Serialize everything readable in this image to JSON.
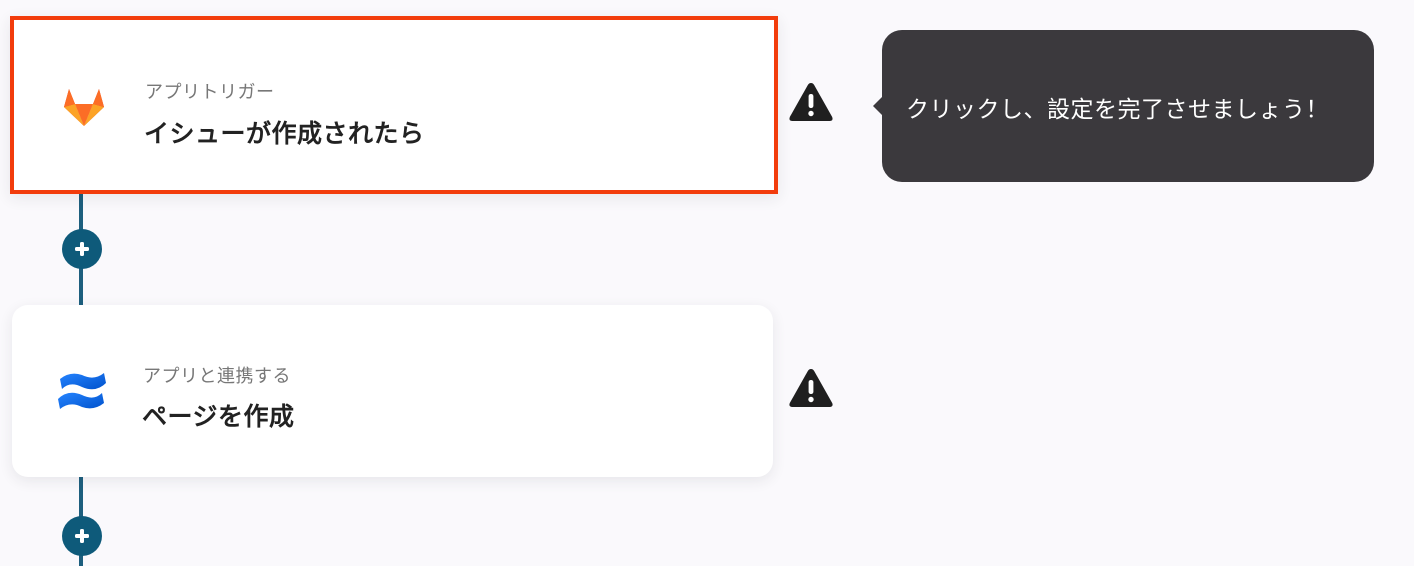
{
  "flow": {
    "steps": [
      {
        "subtitle": "アプリトリガー",
        "title": "イシューが作成されたら",
        "app_icon": "gitlab-icon",
        "selected": true,
        "warning": true
      },
      {
        "subtitle": "アプリと連携する",
        "title": "ページを作成",
        "app_icon": "confluence-icon",
        "selected": false,
        "warning": true
      }
    ],
    "add_step_icon": "plus-icon"
  },
  "tooltip": {
    "text": "クリックし、設定を完了させましょう！"
  },
  "colors": {
    "background": "#faf9fc",
    "selected_border": "#f23c0c",
    "connector": "#1d5f7e",
    "add_button": "#0e5a7a",
    "tooltip_bg": "#3b393d",
    "warning": "#1f1f1f"
  }
}
